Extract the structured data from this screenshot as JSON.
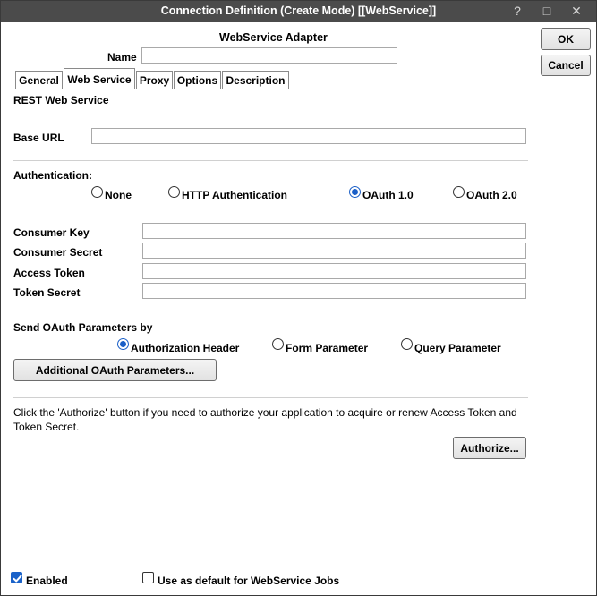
{
  "window": {
    "title": "Connection Definition (Create Mode) [[WebService]]",
    "help_glyph": "?",
    "maximize_glyph": "□",
    "close_glyph": "✕"
  },
  "header": {
    "adapter_title": "WebService Adapter",
    "name_label": "Name",
    "name_value": ""
  },
  "actions": {
    "ok_label": "OK",
    "cancel_label": "Cancel"
  },
  "tabs": [
    {
      "label": "General",
      "active": false
    },
    {
      "label": "Web Service",
      "active": true
    },
    {
      "label": "Proxy",
      "active": false
    },
    {
      "label": "Options",
      "active": false
    },
    {
      "label": "Description",
      "active": false
    }
  ],
  "web_service": {
    "section_title": "REST Web Service",
    "base_url_label": "Base URL",
    "base_url_value": ""
  },
  "authentication": {
    "label": "Authentication:",
    "options": [
      {
        "label": "None",
        "checked": false
      },
      {
        "label": "HTTP Authentication",
        "checked": false
      },
      {
        "label": "OAuth 1.0",
        "checked": true
      },
      {
        "label": "OAuth 2.0",
        "checked": false
      }
    ]
  },
  "oauth_fields": [
    {
      "label": "Consumer Key",
      "value": ""
    },
    {
      "label": "Consumer Secret",
      "value": ""
    },
    {
      "label": "Access Token",
      "value": ""
    },
    {
      "label": "Token Secret",
      "value": ""
    }
  ],
  "send_params": {
    "label": "Send OAuth Parameters by",
    "options": [
      {
        "label": "Authorization Header",
        "checked": true
      },
      {
        "label": "Form Parameter",
        "checked": false
      },
      {
        "label": "Query Parameter",
        "checked": false
      }
    ],
    "additional_button": "Additional OAuth Parameters..."
  },
  "authorize": {
    "info_text": "Click the 'Authorize' button if you need to authorize your application to acquire or renew Access Token and Token Secret.",
    "button": "Authorize..."
  },
  "footer": {
    "enabled_label": "Enabled",
    "enabled_checked": true,
    "default_label": "Use as default for WebService Jobs",
    "default_checked": false
  }
}
